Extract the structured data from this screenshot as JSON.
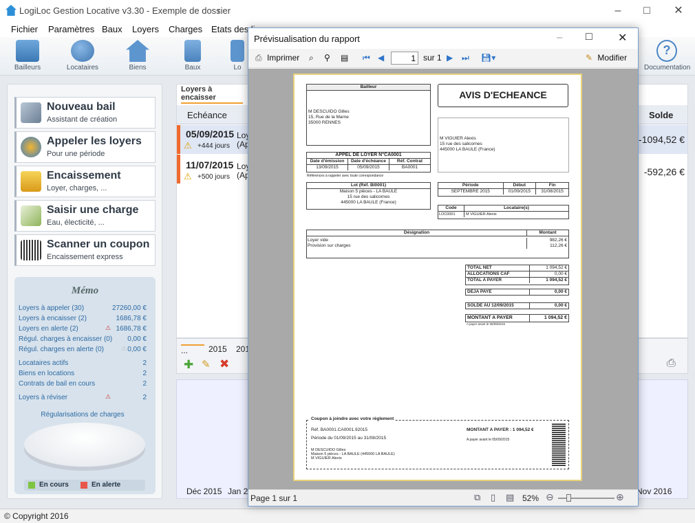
{
  "app": {
    "title": "LogiLoc Gestion Locative v3.30 - Exemple de dossier",
    "title_suffix": "r"
  },
  "menu": [
    "Fichier",
    "Paramètres",
    "Baux",
    "Loyers",
    "Charges",
    "Etats des li"
  ],
  "toolbar": [
    {
      "label": "Bailleurs",
      "icon": "buildings-icon"
    },
    {
      "label": "Locataires",
      "icon": "people-icon"
    },
    {
      "label": "Biens",
      "icon": "house-icon"
    },
    {
      "label": "Baux",
      "icon": "document-icon"
    },
    {
      "label": "Lo",
      "icon": "partial-icon"
    },
    {
      "label": "Documentation",
      "icon": "help-icon"
    }
  ],
  "actions": [
    {
      "title": "Nouveau bail",
      "subtitle": "Assistant de création",
      "icon": "wizard-icon"
    },
    {
      "title": "Appeler les loyers",
      "subtitle": "Pour une période",
      "icon": "gears-icon"
    },
    {
      "title": "Encaissement",
      "subtitle": "Loyer, charges, ...",
      "icon": "cashbox-icon"
    },
    {
      "title": "Saisir une charge",
      "subtitle": "Eau, électicité, ...",
      "icon": "pencil-note-icon"
    },
    {
      "title": "Scanner un coupon",
      "subtitle": "Encaissement express",
      "icon": "barcode-scanner-icon"
    }
  ],
  "memo": {
    "title": "Mémo",
    "rows1": [
      {
        "label": "Loyers à appeler (30)",
        "value": "27260,00 €",
        "warn": false
      },
      {
        "label": "Loyers à encaisser (2)",
        "value": "1686,78 €",
        "warn": false
      },
      {
        "label": "Loyers en alerte (2)",
        "value": "1686,78 €",
        "warn": true
      },
      {
        "label": "Régul. charges à encaisser (0)",
        "value": "0,00 €",
        "warn": false
      },
      {
        "label": "Régul. charges en alerte (0)",
        "value": "0,00 €",
        "warn": true
      }
    ],
    "rows2": [
      {
        "label": "Locataires actifs",
        "value": "2"
      },
      {
        "label": "Biens en locations",
        "value": "2"
      },
      {
        "label": "Contrats de bail en cours",
        "value": "2"
      }
    ],
    "revise": {
      "label": "Loyers à réviser",
      "value": "2"
    },
    "regul_link": "Régularisations de charges",
    "legend": [
      {
        "label": "En cours",
        "color": "#7dc442"
      },
      {
        "label": "En alerte",
        "color": "#e8574a"
      }
    ]
  },
  "main": {
    "tab": "Loyers à encaisser",
    "col_echeance": "Echéance",
    "col_solde": "Solde",
    "rows": [
      {
        "date": "05/09/2015",
        "days": "+444 jours",
        "solde": "-1094,52 €",
        "partial": "Loy",
        "partial2": "(Ap"
      },
      {
        "date": "11/07/2015",
        "days": "+500 jours",
        "solde": "-592,26 €",
        "partial": "Loy",
        "partial2": "(Ap"
      }
    ],
    "years": [
      "...",
      "2015",
      "201"
    ],
    "chart_labels": [
      "Déc 2015",
      "Jan 2",
      "Nov 2016"
    ]
  },
  "status": "© Copyright 2016",
  "dialog": {
    "title": "Prévisualisation du rapport",
    "print": "Imprimer",
    "page_value": "1",
    "page_of": "sur 1",
    "modify": "Modifier",
    "status_page": "Page 1 sur 1",
    "zoom": "52%"
  },
  "report": {
    "bailleur_h": "Bailleur",
    "bailleur": [
      "M DESCUIDO Gilles",
      "15, Rue de la Marne",
      "35000 RENNES"
    ],
    "avis": "AVIS D'ECHEANCE",
    "locataire": [
      "M VIGUIER Alexis",
      "15 rue des salicornes",
      "445000 LA BAULE (France)"
    ],
    "appel_h": "APPEL DE LOYER N°CA0001",
    "appel_cols": [
      "Date d'émission",
      "Date d'échéance",
      "Réf. Contrat"
    ],
    "appel_vals": [
      "13/09/2015",
      "05/09/2015",
      "BA0001"
    ],
    "ref_note": "Références à rappeler avec toute correspondance",
    "lot_h": "Lot (Réf. BI0001)",
    "lot": [
      "Maison 5 pièces - LA BAULE",
      "15 rue des salicornes",
      "445000 LA BAULE (France)"
    ],
    "periode_cols": [
      "Période",
      "Début",
      "Fin"
    ],
    "periode_vals": [
      "SEPTEMBRE 2015",
      "01/09/2015",
      "31/08/2015"
    ],
    "loc_cols": [
      "Code",
      "Locataire(s)"
    ],
    "loc_vals": [
      "LOC0001",
      "M VIGUIER Alexis"
    ],
    "des_cols": [
      "Désignation",
      "Montant"
    ],
    "lines": [
      {
        "d": "Loyer vide",
        "m": "982,26 €"
      },
      {
        "d": "Provision sur charges",
        "m": "112,26 €"
      }
    ],
    "totals": [
      {
        "l": "TOTAL NET",
        "v": "1 094,52 €"
      },
      {
        "l": "ALLOCATIONS CAF",
        "v": "0,00 €"
      },
      {
        "l": "TOTAL A PAYER",
        "v": "1 094,52 €"
      }
    ],
    "deja": {
      "l": "DEJA PAYE",
      "v": "0,00 €"
    },
    "solde": {
      "l": "SOLDE AU 12/09/2015",
      "v": "0,00 €"
    },
    "montant": {
      "l": "MONTANT A PAYER",
      "v": "1 094,52 €"
    },
    "footnote": "A payer avant le 05/09/2015",
    "coupon_h": "Coupon à joindre avec votre règlement",
    "coupon_ref": "Réf. BA0001.CA0001.92015",
    "coupon_per": "Période du 01/09/2015 au 31/08/2015",
    "coupon_amt": "MONTANT A PAYER : 1 094,52 €",
    "coupon_due": "A payer avant le 05/09/2015",
    "coupon_addr": [
      "M DESCUIDO Gilles",
      "Maison 5 pièces - LA BAULE (445000 LA BAULE)",
      "M VIGUIER Alexis"
    ]
  }
}
